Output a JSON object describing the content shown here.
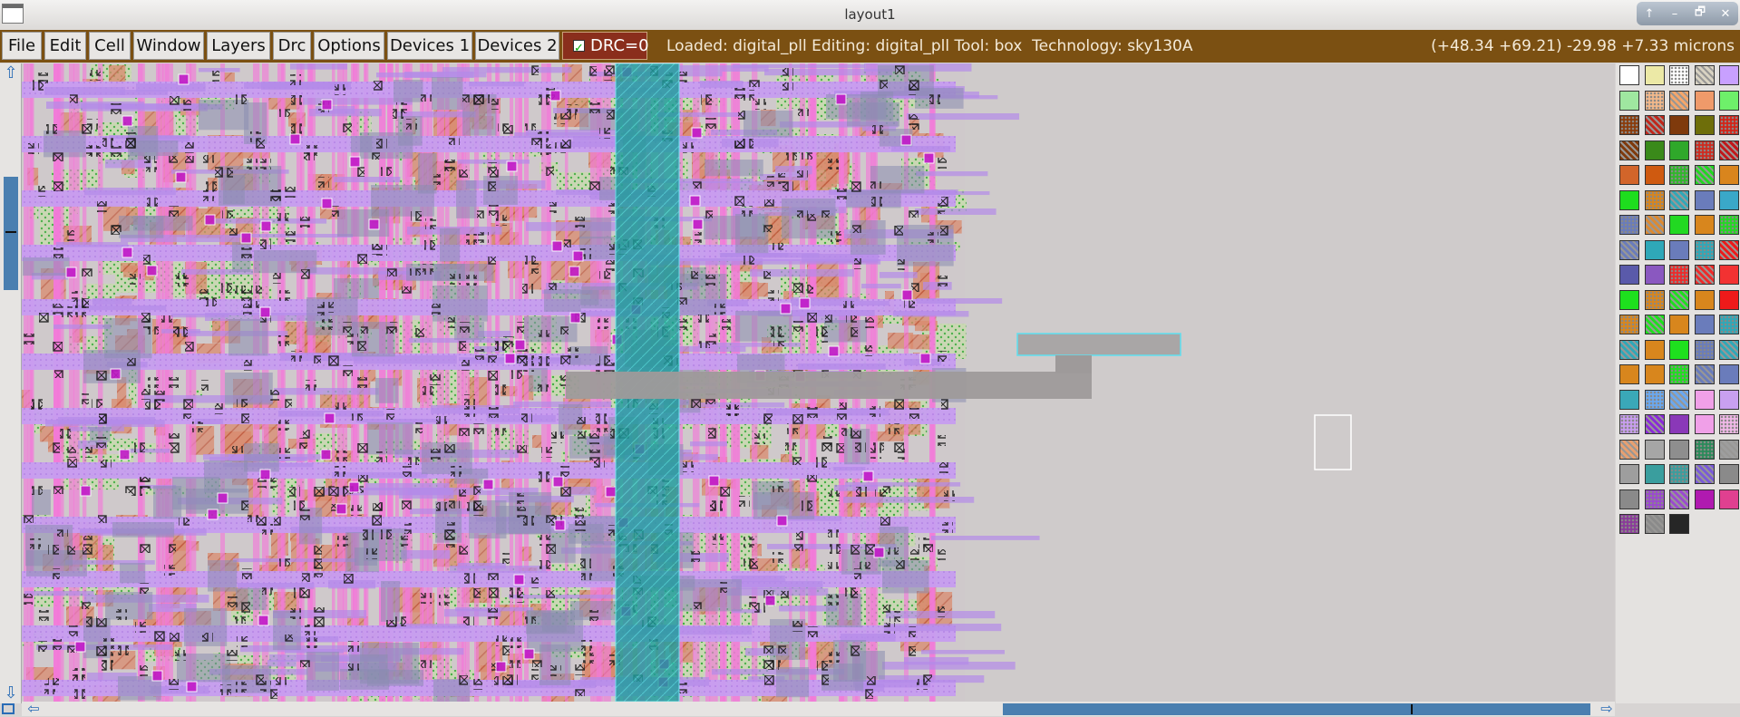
{
  "window": {
    "title": "layout1",
    "controls": [
      "↑",
      "–",
      "🗗",
      "✕"
    ]
  },
  "menu": [
    {
      "id": "file",
      "label": "File"
    },
    {
      "id": "edit",
      "label": "Edit"
    },
    {
      "id": "cell",
      "label": "Cell"
    },
    {
      "id": "window",
      "label": "Window"
    },
    {
      "id": "layers",
      "label": "Layers"
    },
    {
      "id": "drc",
      "label": "Drc"
    },
    {
      "id": "options",
      "label": "Options"
    },
    {
      "id": "devices-1",
      "label": "Devices 1"
    },
    {
      "id": "devices-2",
      "label": "Devices 2"
    }
  ],
  "drc_toggle": {
    "label": "DRC=0",
    "checked": true
  },
  "status": {
    "text": "Loaded: digital_pll Editing: digital_pll Tool: box  Technology: sky130A",
    "coords": "(+48.34 +69.21) -29.98 +7.33 microns"
  },
  "colors": {
    "titlebar": "#dcdad8",
    "menubar": "#7b5012",
    "canvas": "#cfcbcb",
    "accent": "#4a7fb0",
    "drc": "#8a2e1c"
  },
  "layer_palette": [
    "#ffffff",
    "#ece9a6",
    "#ffffff",
    "#d8d2c2",
    "#c8a0ff",
    "#9fe7a0",
    "#f2b88a",
    "#f5a66a",
    "#ef9a6a",
    "#6ef06a",
    "#8a3b0a",
    "#c0271b",
    "#7f3a0c",
    "#6e6e0a",
    "#d22418",
    "#7f3a0c",
    "#3a8a1a",
    "#2fa82a",
    "#cf2a1e",
    "#c2171a",
    "#d2652a",
    "#cf5a10",
    "#2fb82a",
    "#22d622",
    "#d9851d",
    "#1edd1e",
    "#d8861d",
    "#30a8b8",
    "#6a7cbb",
    "#3aa8c8",
    "#6a7cbb",
    "#dc8a32",
    "#22d922",
    "#d8861d",
    "#22d922",
    "#6a7cbb",
    "#2fa8b8",
    "#6a7cbb",
    "#2fa8b8",
    "#ee1a1a",
    "#5a5aaa",
    "#8a58c0",
    "#ee2a2a",
    "#ee2a2a",
    "#f23232",
    "#1ee01e",
    "#d8861d",
    "#1ee01e",
    "#d8861d",
    "#ee1a1a",
    "#d8861d",
    "#1ee01e",
    "#d8861d",
    "#6a7cbb",
    "#2fa8b8",
    "#2fa8b8",
    "#d8861d",
    "#1ee01e",
    "#6a7cbb",
    "#2fa8b8",
    "#d8861d",
    "#d8861d",
    "#1ee01e",
    "#6a7cbb",
    "#6a7cbb",
    "#3aa8b8",
    "#6aa8f0",
    "#6aa8f0",
    "#f0a0e8",
    "#c8a0f0",
    "#c89ef0",
    "#8a2ad8",
    "#8a38b8",
    "#f0a0e8",
    "#f0b8e8",
    "#e8a070",
    "#a6a6a6",
    "#8e8e8e",
    "#2a8a5a",
    "#9e9e9e",
    "#9e9e9e",
    "#3a9e9e",
    "#3a9e9e",
    "#7a5ad8",
    "#8a8a8a",
    "#8a8a8a",
    "#9b4ad0",
    "#9b4ad0",
    "#b01ab0",
    "#e04090",
    "#8a3a9a",
    "#8a8a8a",
    "#262626"
  ]
}
